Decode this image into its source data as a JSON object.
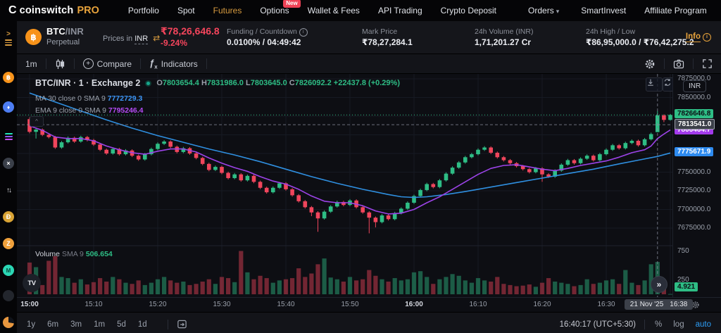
{
  "colors": {
    "accent_gold": "#e8a33b",
    "active_tab": "#d79b3f",
    "negative_red": "#f5455c",
    "link_blue": "#2d9cf4",
    "up_green": "#2ebd85",
    "down_red": "#f0455c"
  },
  "navbar": {
    "logo_glyph": "C",
    "logo_name": "coinswitch",
    "logo_pro": "PRO",
    "new_badge": "New",
    "caret": "▾",
    "items": [
      {
        "label": "Portfolio"
      },
      {
        "label": "Spot"
      },
      {
        "label": "Futures"
      },
      {
        "label": "Options"
      },
      {
        "label": "Wallet & Fees"
      },
      {
        "label": "API Trading"
      },
      {
        "label": "Crypto Deposit"
      },
      {
        "label": "Orders"
      },
      {
        "label": "SmartInvest"
      },
      {
        "label": "Affiliate Program"
      }
    ]
  },
  "sidebar": {
    "expand_glyph": ">",
    "icons": [
      {
        "name": "btc",
        "glyph": "฿"
      },
      {
        "name": "eth",
        "glyph": "♦"
      },
      {
        "name": "sol",
        "glyph": ""
      },
      {
        "name": "x",
        "glyph": "×"
      },
      {
        "name": "updown",
        "glyph": "↑↓"
      },
      {
        "name": "doge",
        "glyph": "Ð"
      },
      {
        "name": "zec",
        "glyph": "Z"
      },
      {
        "name": "teal-coin",
        "glyph": "M"
      },
      {
        "name": "dim-coin",
        "glyph": ""
      },
      {
        "name": "pie-coin",
        "glyph": ""
      }
    ]
  },
  "ticker": {
    "coin_glyph": "฿",
    "pair_base": "BTC",
    "pair_sep": "/",
    "pair_quote": "INR",
    "contract": "Perpetual",
    "prices_in": "Prices in",
    "currency": "INR",
    "swap_icon": "⇄",
    "last_price": "₹78,26,646.8",
    "change_pct": "-9.24%",
    "funding_label": "Funding / Countdown",
    "funding_value": "0.0100% / 04:49:42",
    "info_glyph": "i",
    "mark_label": "Mark Price",
    "mark_value": "₹78,27,284.1",
    "volume_label": "24h Volume (INR)",
    "volume_value": "1,71,201.27 Cr",
    "hl_label": "24h High / Low",
    "hl_value": "₹86,95,000.0 / ₹76,42,275.2",
    "info_link": "Info"
  },
  "chart_toolbar": {
    "interval": "1m",
    "compare": "Compare",
    "indicators": "Indicators",
    "plus": "+",
    "fx": "ƒ",
    "fx_sub": "x"
  },
  "chart": {
    "inr_button": "INR",
    "legend_symbol": "BTC/INR · 1 · Exchange 2",
    "ohlc": {
      "o_l": "O",
      "o": "7803654.4",
      "h_l": "H",
      "h": "7831986.0",
      "l_l": "L",
      "l": "7803645.0",
      "c_l": "C",
      "c": "7826092.2",
      "change": "+22437.8 (+0.29%)"
    },
    "ma_label": "MA 30 close 0 SMA 9",
    "ma_value": "7772729.3",
    "ema_label": "EMA 9 close 0 SMA 9",
    "ema_value": "7795246.4",
    "volume_label": "Volume",
    "volume_sma_label": "SMA 9",
    "volume_sma_value": "506.654",
    "collapse_glyph": "^",
    "scroll_glyph": "»"
  },
  "chart_data": {
    "type": "candlestick",
    "title": "BTC/INR · 1 · Exchange 2",
    "interval_minutes": 1,
    "start_time": "15:00",
    "end_time": "16:40",
    "ylim": [
      7662000,
      7881600
    ],
    "volume_ylim": [
      0,
      800
    ],
    "grid": true,
    "colors": {
      "up": "#2ebd85",
      "down": "#f0455c",
      "up_vol": "rgba(46,189,133,0.45)",
      "down_vol": "rgba(240,69,92,0.45)",
      "ma": "#2f8fe0",
      "ema": "#9c43e8",
      "last_line": "#2ebd85",
      "crosshair": "#8b90a0",
      "grid": "#161a23",
      "separator": "#1e222c"
    },
    "price_gridlines": [
      7875000,
      7850000,
      7825000,
      7800000,
      7775000,
      7750000,
      7725000,
      7700000,
      7675000
    ],
    "price_axis_labels": [
      {
        "label": "7875000.0",
        "price": 7875000
      },
      {
        "label": "7850000.0",
        "price": 7850000
      },
      {
        "label": "7750000.0",
        "price": 7750000
      },
      {
        "label": "7725000.0",
        "price": 7725000
      },
      {
        "label": "7700000.0",
        "price": 7700000
      },
      {
        "label": "7675000.0",
        "price": 7675000
      }
    ],
    "price_badges": [
      {
        "label": "7826646.8",
        "price": 7826646.8,
        "kind": "last"
      },
      {
        "label": "7813541.0",
        "price": 7813541.0,
        "kind": "cross"
      },
      {
        "label": "7806464.7",
        "price": 7805000.0,
        "kind": "ema"
      },
      {
        "label": "7775671.9",
        "price": 7775671.9,
        "kind": "ma"
      }
    ],
    "volume_axis_labels": [
      {
        "label": "750",
        "value": 750
      },
      {
        "label": "250",
        "value": 250
      }
    ],
    "volume_badge": {
      "label": "4.921"
    },
    "time_labels": [
      {
        "m": 0,
        "label": "15:00",
        "bold": true
      },
      {
        "m": 10,
        "label": "15:10"
      },
      {
        "m": 20,
        "label": "15:20"
      },
      {
        "m": 30,
        "label": "15:30"
      },
      {
        "m": 40,
        "label": "15:40"
      },
      {
        "m": 50,
        "label": "15:50"
      },
      {
        "m": 60,
        "label": "16:00",
        "bold": true
      },
      {
        "m": 70,
        "label": "16:10"
      },
      {
        "m": 80,
        "label": "16:20"
      },
      {
        "m": 90,
        "label": "16:30"
      }
    ],
    "last_price": 7826646.8,
    "crosshair": {
      "price": 7813541.0,
      "minute": 98,
      "date": "21 Nov '25",
      "time": "16:38"
    },
    "candles": [
      [
        7821000,
        7823500,
        7802000,
        7804000,
        550
      ],
      [
        7804000,
        7808800,
        7795000,
        7807000,
        470
      ],
      [
        7807000,
        7808600,
        7798200,
        7800000,
        160
      ],
      [
        7800000,
        7801600,
        7795200,
        7797000,
        580
      ],
      [
        7797000,
        7798600,
        7781200,
        7783000,
        660
      ],
      [
        7783000,
        7791800,
        7781400,
        7790000,
        300
      ],
      [
        7790000,
        7797800,
        7788400,
        7796000,
        280
      ],
      [
        7796000,
        7797600,
        7789200,
        7791000,
        200
      ],
      [
        7791000,
        7798800,
        7789400,
        7797000,
        260
      ],
      [
        7797000,
        7798600,
        7791200,
        7793000,
        170
      ],
      [
        7793000,
        7794600,
        7785200,
        7787000,
        210
      ],
      [
        7787000,
        7788600,
        7778200,
        7780000,
        280
      ],
      [
        7780000,
        7781600,
        7773200,
        7775000,
        220
      ],
      [
        7775000,
        7782800,
        7773400,
        7781000,
        300
      ],
      [
        7781000,
        7782600,
        7772200,
        7774000,
        260
      ],
      [
        7774000,
        7780800,
        7772400,
        7779000,
        200
      ],
      [
        7779000,
        7780600,
        7770200,
        7772000,
        180
      ],
      [
        7772000,
        7773600,
        7765200,
        7767000,
        240
      ],
      [
        7767000,
        7775800,
        7765400,
        7774000,
        160
      ],
      [
        7774000,
        7782800,
        7772400,
        7781000,
        200
      ],
      [
        7781000,
        7789800,
        7779400,
        7788000,
        260
      ],
      [
        7788000,
        7792800,
        7786400,
        7791000,
        300
      ],
      [
        7791000,
        7792600,
        7782200,
        7784000,
        240
      ],
      [
        7784000,
        7785600,
        7775200,
        7777000,
        200
      ],
      [
        7777000,
        7783800,
        7775400,
        7782000,
        220
      ],
      [
        7782000,
        7783600,
        7773200,
        7775000,
        160
      ],
      [
        7775000,
        7776600,
        7767200,
        7769000,
        180
      ],
      [
        7769000,
        7770600,
        7759200,
        7761000,
        220
      ],
      [
        7761000,
        7762600,
        7751200,
        7753000,
        260
      ],
      [
        7753000,
        7758800,
        7751400,
        7757000,
        180
      ],
      [
        7757000,
        7758600,
        7747200,
        7749000,
        300
      ],
      [
        7749000,
        7750600,
        7740200,
        7742000,
        280
      ],
      [
        7742000,
        7748800,
        7740400,
        7747000,
        210
      ],
      [
        7747000,
        7748600,
        7737200,
        7739000,
        750
      ],
      [
        7739000,
        7746800,
        7737400,
        7745000,
        380
      ],
      [
        7745000,
        7746600,
        7735200,
        7737000,
        260
      ],
      [
        7737000,
        7738600,
        7727200,
        7729000,
        320
      ],
      [
        7729000,
        7730600,
        7721200,
        7723000,
        280
      ],
      [
        7723000,
        7730800,
        7721400,
        7729000,
        200
      ],
      [
        7729000,
        7736800,
        7727400,
        7735000,
        240
      ],
      [
        7735000,
        7736600,
        7725200,
        7727000,
        260
      ],
      [
        7727000,
        7728600,
        7717200,
        7719000,
        280
      ],
      [
        7719000,
        7720600,
        7709200,
        7711000,
        450
      ],
      [
        7711000,
        7712600,
        7701200,
        7703000,
        300
      ],
      [
        7703000,
        7704600,
        7691000,
        7696000,
        360
      ],
      [
        7696000,
        7697600,
        7670000,
        7688000,
        520
      ],
      [
        7688000,
        7698800,
        7686400,
        7697000,
        620
      ],
      [
        7697000,
        7705800,
        7695400,
        7704000,
        290
      ],
      [
        7704000,
        7711800,
        7702400,
        7710000,
        260
      ],
      [
        7710000,
        7711600,
        7704200,
        7706000,
        220
      ],
      [
        7706000,
        7713800,
        7704400,
        7712000,
        300
      ],
      [
        7712000,
        7713600,
        7701200,
        7703000,
        240
      ],
      [
        7703000,
        7704600,
        7694200,
        7696000,
        260
      ],
      [
        7696000,
        7697600,
        7668000,
        7689000,
        420
      ],
      [
        7689000,
        7690600,
        7676000,
        7683000,
        320
      ],
      [
        7683000,
        7693800,
        7681400,
        7692000,
        260
      ],
      [
        7692000,
        7693600,
        7685200,
        7687000,
        220
      ],
      [
        7687000,
        7696800,
        7685400,
        7695000,
        280
      ],
      [
        7695000,
        7702800,
        7693400,
        7701000,
        240
      ],
      [
        7701000,
        7710800,
        7699400,
        7709000,
        260
      ],
      [
        7709000,
        7719800,
        7707400,
        7718000,
        380
      ],
      [
        7718000,
        7727800,
        7716400,
        7726000,
        400
      ],
      [
        7726000,
        7735800,
        7724400,
        7734000,
        300
      ],
      [
        7734000,
        7735600,
        7728200,
        7730000,
        180
      ],
      [
        7730000,
        7740800,
        7728400,
        7739000,
        260
      ],
      [
        7739000,
        7749800,
        7737400,
        7748000,
        300
      ],
      [
        7748000,
        7757800,
        7746400,
        7756000,
        350
      ],
      [
        7756000,
        7764800,
        7754400,
        7763000,
        320
      ],
      [
        7763000,
        7771800,
        7761400,
        7770000,
        240
      ],
      [
        7770000,
        7775800,
        7768400,
        7774000,
        200
      ],
      [
        7774000,
        7781800,
        7772400,
        7780000,
        280
      ],
      [
        7780000,
        7784800,
        7778400,
        7783000,
        240
      ],
      [
        7783000,
        7784600,
        7774200,
        7776000,
        220
      ],
      [
        7776000,
        7777600,
        7768200,
        7770000,
        300
      ],
      [
        7770000,
        7771600,
        7764200,
        7766000,
        180
      ],
      [
        7766000,
        7767600,
        7760200,
        7762000,
        160
      ],
      [
        7762000,
        7763600,
        7756200,
        7758000,
        140
      ],
      [
        7758000,
        7759600,
        7752200,
        7754000,
        150
      ],
      [
        7754000,
        7755600,
        7748200,
        7750000,
        170
      ],
      [
        7750000,
        7756800,
        7748400,
        7755000,
        130
      ],
      [
        7755000,
        7756600,
        7737000,
        7747000,
        200
      ],
      [
        7747000,
        7748600,
        7742200,
        7744000,
        280
      ],
      [
        7744000,
        7753800,
        7742400,
        7752000,
        220
      ],
      [
        7752000,
        7761800,
        7750400,
        7760000,
        200
      ],
      [
        7760000,
        7767800,
        7758400,
        7766000,
        180
      ],
      [
        7766000,
        7767600,
        7760200,
        7762000,
        140
      ],
      [
        7762000,
        7769800,
        7760400,
        7768000,
        160
      ],
      [
        7768000,
        7773800,
        7766400,
        7772000,
        260
      ],
      [
        7772000,
        7773600,
        7764200,
        7766000,
        180
      ],
      [
        7766000,
        7775800,
        7764400,
        7774000,
        200
      ],
      [
        7774000,
        7781800,
        7772400,
        7780000,
        240
      ],
      [
        7780000,
        7787800,
        7778400,
        7786000,
        260
      ],
      [
        7786000,
        7787600,
        7780200,
        7782000,
        180
      ],
      [
        7782000,
        7790800,
        7780400,
        7789000,
        420
      ],
      [
        7789000,
        7793800,
        7787400,
        7792000,
        200
      ],
      [
        7792000,
        7793600,
        7784200,
        7786000,
        160
      ],
      [
        7786000,
        7795800,
        7784400,
        7794000,
        240
      ],
      [
        7794000,
        7803000,
        7792400,
        7801000,
        520
      ],
      [
        7803654,
        7831986,
        7803645,
        7826092,
        560
      ],
      [
        7826092,
        7827500,
        7817000,
        7820000,
        180
      ],
      [
        7820000,
        7828000,
        7819000,
        7826646.8,
        4.921
      ]
    ],
    "ma30": [
      [
        0,
        7856000
      ],
      [
        4,
        7844000
      ],
      [
        8,
        7832000
      ],
      [
        12,
        7820000
      ],
      [
        16,
        7809000
      ],
      [
        20,
        7799000
      ],
      [
        24,
        7790000
      ],
      [
        28,
        7781000
      ],
      [
        32,
        7773000
      ],
      [
        36,
        7764000
      ],
      [
        40,
        7754000
      ],
      [
        44,
        7744000
      ],
      [
        48,
        7735000
      ],
      [
        52,
        7727000
      ],
      [
        56,
        7720000
      ],
      [
        58,
        7717000
      ],
      [
        60,
        7716000
      ],
      [
        62,
        7717000
      ],
      [
        65,
        7720000
      ],
      [
        68,
        7724000
      ],
      [
        72,
        7730000
      ],
      [
        76,
        7736000
      ],
      [
        80,
        7742000
      ],
      [
        84,
        7748000
      ],
      [
        88,
        7754000
      ],
      [
        92,
        7761000
      ],
      [
        95,
        7766000
      ],
      [
        98,
        7771000
      ],
      [
        100,
        7775672
      ]
    ],
    "ema9": [
      [
        0,
        7812000
      ],
      [
        2,
        7806000
      ],
      [
        4,
        7797000
      ],
      [
        6,
        7795000
      ],
      [
        8,
        7795000
      ],
      [
        10,
        7792000
      ],
      [
        12,
        7785000
      ],
      [
        14,
        7780000
      ],
      [
        16,
        7776000
      ],
      [
        18,
        7774000
      ],
      [
        20,
        7778000
      ],
      [
        22,
        7781000
      ],
      [
        24,
        7781000
      ],
      [
        26,
        7777000
      ],
      [
        28,
        7769000
      ],
      [
        30,
        7762000
      ],
      [
        32,
        7756000
      ],
      [
        34,
        7751000
      ],
      [
        36,
        7744000
      ],
      [
        38,
        7738000
      ],
      [
        40,
        7734000
      ],
      [
        42,
        7727000
      ],
      [
        44,
        7718000
      ],
      [
        46,
        7711000
      ],
      [
        48,
        7709000
      ],
      [
        50,
        7709000
      ],
      [
        52,
        7705000
      ],
      [
        54,
        7698000
      ],
      [
        56,
        7694000
      ],
      [
        58,
        7695000
      ],
      [
        60,
        7700000
      ],
      [
        62,
        7709000
      ],
      [
        64,
        7717000
      ],
      [
        66,
        7727000
      ],
      [
        68,
        7737000
      ],
      [
        70,
        7747000
      ],
      [
        72,
        7755000
      ],
      [
        74,
        7759000
      ],
      [
        76,
        7760000
      ],
      [
        78,
        7757000
      ],
      [
        80,
        7754000
      ],
      [
        82,
        7752000
      ],
      [
        84,
        7755000
      ],
      [
        86,
        7759000
      ],
      [
        88,
        7762000
      ],
      [
        90,
        7765000
      ],
      [
        92,
        7770000
      ],
      [
        94,
        7776000
      ],
      [
        96,
        7780000
      ],
      [
        97,
        7785000
      ],
      [
        98,
        7795000
      ],
      [
        99,
        7801000
      ],
      [
        100,
        7806465
      ]
    ]
  },
  "time_axis_badge": {
    "date": "21 Nov '25",
    "time": "16:38"
  },
  "bottom_bar": {
    "timeframes": [
      {
        "label": "1y"
      },
      {
        "label": "6m"
      },
      {
        "label": "3m"
      },
      {
        "label": "1m"
      },
      {
        "label": "5d"
      },
      {
        "label": "1d"
      }
    ],
    "clock": "16:40:17 (UTC+5:30)",
    "percent": "%",
    "log": "log",
    "auto": "auto"
  }
}
